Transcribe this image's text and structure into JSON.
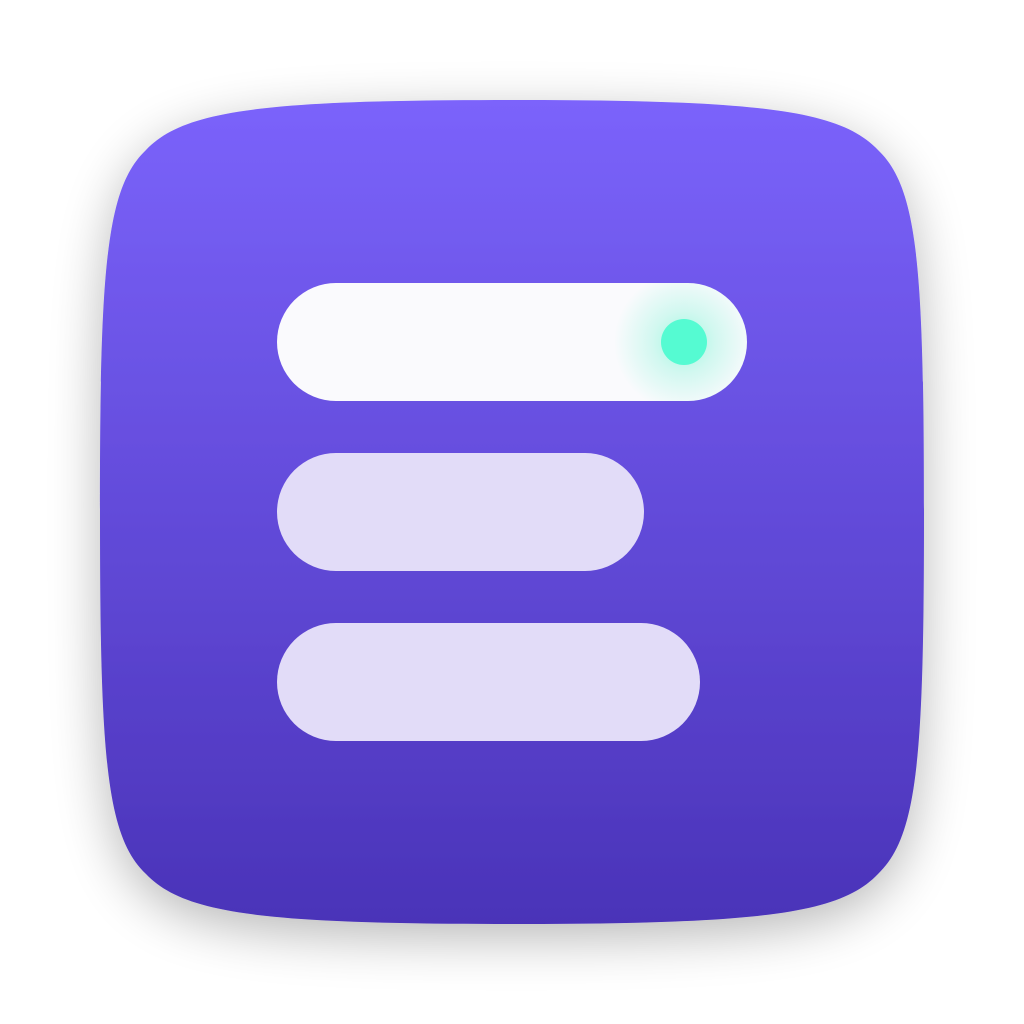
{
  "icon": {
    "name": "menu-list-app-icon",
    "colors": {
      "background_top": "#7B63FB",
      "background_bottom": "#4A33B8",
      "primary_bar": "#FAFAFD",
      "secondary_bar": "#E2DCF8",
      "indicator_dot": "#55FBD2",
      "indicator_glow": "#5BF3C9"
    },
    "bars": [
      {
        "role": "primary",
        "has_indicator": true
      },
      {
        "role": "secondary",
        "has_indicator": false
      },
      {
        "role": "secondary",
        "has_indicator": false
      }
    ]
  }
}
